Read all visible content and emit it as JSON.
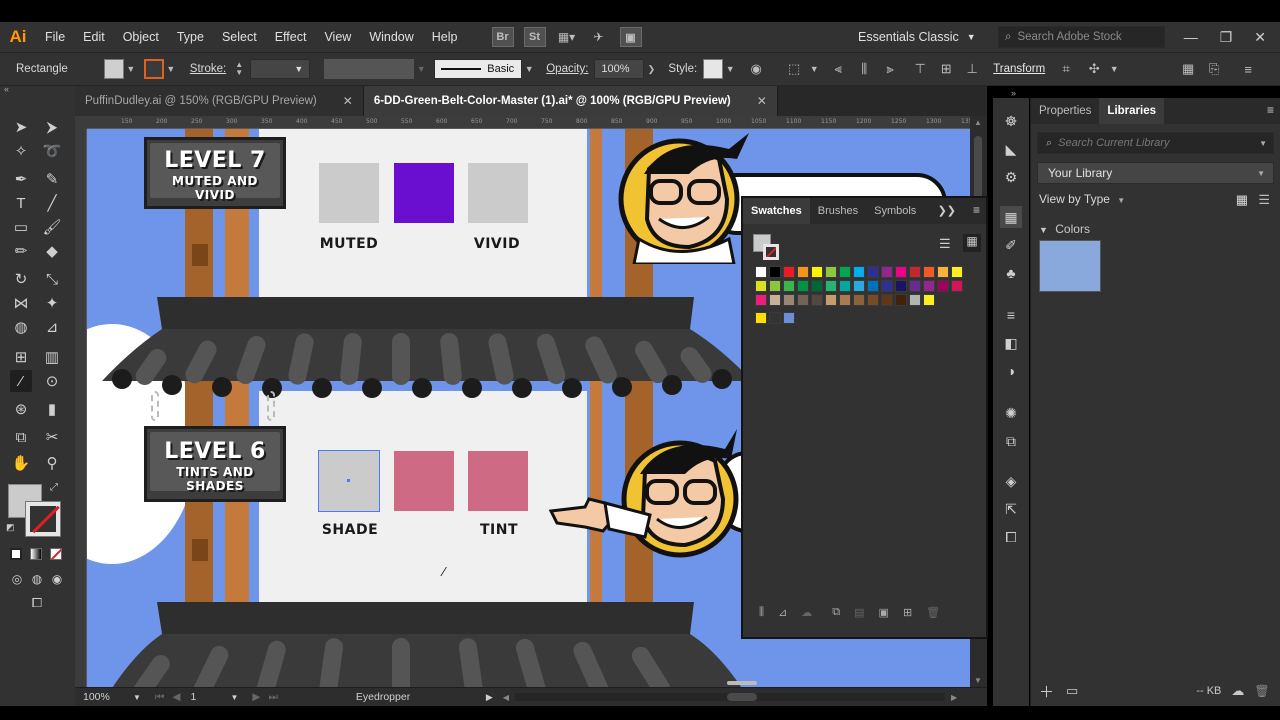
{
  "app": {
    "logo": "Ai",
    "menu": [
      "File",
      "Edit",
      "Object",
      "Type",
      "Select",
      "Effect",
      "View",
      "Window",
      "Help"
    ],
    "bridge_icon": "Br",
    "stock_icon": "St",
    "workspace": "Essentials Classic",
    "stock_search_placeholder": "Search Adobe Stock"
  },
  "control_bar": {
    "tool_name": "Rectangle",
    "stroke_label": "Stroke:",
    "stroke_profile": "Basic",
    "opacity_label": "Opacity:",
    "opacity_value": "100%",
    "style_label": "Style:",
    "transform_link": "Transform"
  },
  "tabs": [
    {
      "label": "PuffinDudley.ai @ 150% (RGB/GPU Preview)",
      "active": false
    },
    {
      "label": "6-DD-Green-Belt-Color-Master (1).ai* @ 100% (RGB/GPU Preview)",
      "active": true
    }
  ],
  "ruler_ticks": [
    "150",
    "200",
    "250",
    "300",
    "350",
    "400",
    "450",
    "500",
    "550",
    "600",
    "650",
    "700",
    "750",
    "800",
    "850",
    "900",
    "950",
    "1000",
    "1050",
    "1100",
    "1150",
    "1200",
    "1250",
    "1300",
    "1350",
    "1400"
  ],
  "artwork": {
    "level7": {
      "title": "LEVEL 7",
      "subtitle_line1": "MUTED AND",
      "subtitle_line2": "VIVID"
    },
    "level6": {
      "title": "LEVEL 6",
      "subtitle_line1": "TINTS AND",
      "subtitle_line2": "SHADES"
    },
    "muted_label": "MUTED",
    "vivid_label": "VIVID",
    "shade_label": "SHADE",
    "tint_label": "TINT",
    "colors": {
      "muted": "#cbcbcb",
      "vivid": "#6a0fd0",
      "vivid_right": "#cbcbcb",
      "shade": "#cbcbcb",
      "pink": "#cf6a85",
      "sky": "#6f95ea",
      "wood": "#a5632c",
      "roof": "#3a3a3a"
    }
  },
  "status_bar": {
    "zoom": "100%",
    "artboard": "1",
    "tool": "Eyedropper"
  },
  "swatches_panel": {
    "tabs": [
      "Swatches",
      "Brushes",
      "Symbols"
    ],
    "active_tab": "Swatches",
    "row1": [
      "#ffffff",
      "#000000",
      "#ed1c24",
      "#f7941d",
      "#fff200",
      "#8dc63f",
      "#00a651",
      "#00aeef",
      "#2e3192",
      "#92278f",
      "#ec008c",
      "#c1272d",
      "#f15a24",
      "#fbb03b",
      "#fcee21"
    ],
    "row2": [
      "#d9e021",
      "#8cc63f",
      "#39b54a",
      "#009245",
      "#006837",
      "#22b573",
      "#00a99d",
      "#29abe2",
      "#0071bc",
      "#2e3192",
      "#1b1464",
      "#662d91",
      "#93278f",
      "#9e005d",
      "#d4145a"
    ],
    "row3": [
      "#ed1e79",
      "#c7b299",
      "#998675",
      "#736357",
      "#534741",
      "#c69c6d",
      "#a67c52",
      "#8c6239",
      "#754c24",
      "#603813",
      "#42210b",
      "#b3b3b3",
      "#fcee21"
    ],
    "row4": [
      "#ffde00",
      "#333333",
      "#6c8ed6"
    ]
  },
  "right_panel": {
    "tabs": [
      "Properties",
      "Libraries"
    ],
    "active_tab": "Libraries",
    "search_placeholder": "Search Current Library",
    "library": "Your Library",
    "view_by": "View by Type",
    "section": "Colors",
    "swatch_color": "#89a8db",
    "size": "-- KB"
  }
}
